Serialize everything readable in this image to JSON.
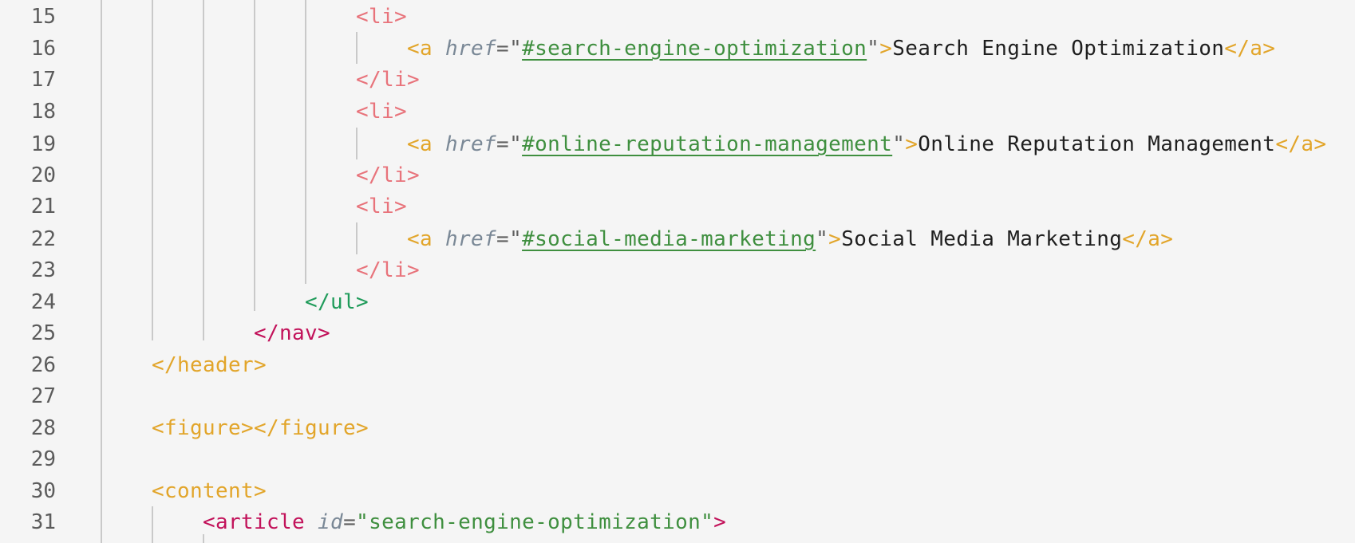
{
  "editor": {
    "colors": {
      "background": "#f5f5f5",
      "line_number": "#5c5c5c",
      "li_tag": "#e8737b",
      "a_tag": "#e2a52a",
      "ul_tag": "#1f9b5a",
      "nav_tag": "#c2125a",
      "attribute": "#7a8896",
      "string": "#3f8f3f"
    },
    "lines": [
      {
        "number": "15",
        "tokens": [
          "<li>"
        ]
      },
      {
        "number": "16",
        "tokens": [
          "<a",
          "href",
          "=",
          "\"",
          "#search-engine-optimization",
          "\"",
          ">",
          "Search Engine Optimization",
          "</a>"
        ]
      },
      {
        "number": "17",
        "tokens": [
          "</li>"
        ]
      },
      {
        "number": "18",
        "tokens": [
          "<li>"
        ]
      },
      {
        "number": "19",
        "tokens": [
          "<a",
          "href",
          "=",
          "\"",
          "#online-reputation-management",
          "\"",
          ">",
          "Online Reputation Management",
          "</a>"
        ]
      },
      {
        "number": "20",
        "tokens": [
          "</li>"
        ]
      },
      {
        "number": "21",
        "tokens": [
          "<li>"
        ]
      },
      {
        "number": "22",
        "tokens": [
          "<a",
          "href",
          "=",
          "\"",
          "#social-media-marketing",
          "\"",
          ">",
          "Social Media Marketing",
          "</a>"
        ]
      },
      {
        "number": "23",
        "tokens": [
          "</li>"
        ]
      },
      {
        "number": "24",
        "tokens": [
          "</ul>"
        ]
      },
      {
        "number": "25",
        "tokens": [
          "</nav>"
        ]
      },
      {
        "number": "26",
        "tokens": [
          "</header>"
        ]
      },
      {
        "number": "27",
        "tokens": []
      },
      {
        "number": "28",
        "tokens": [
          "<figure>",
          "</figure>"
        ]
      },
      {
        "number": "29",
        "tokens": []
      },
      {
        "number": "30",
        "tokens": [
          "<content>"
        ]
      },
      {
        "number": "31",
        "tokens": [
          "<article",
          "id",
          "=",
          "\"search-engine-optimization\"",
          ">"
        ]
      }
    ]
  }
}
